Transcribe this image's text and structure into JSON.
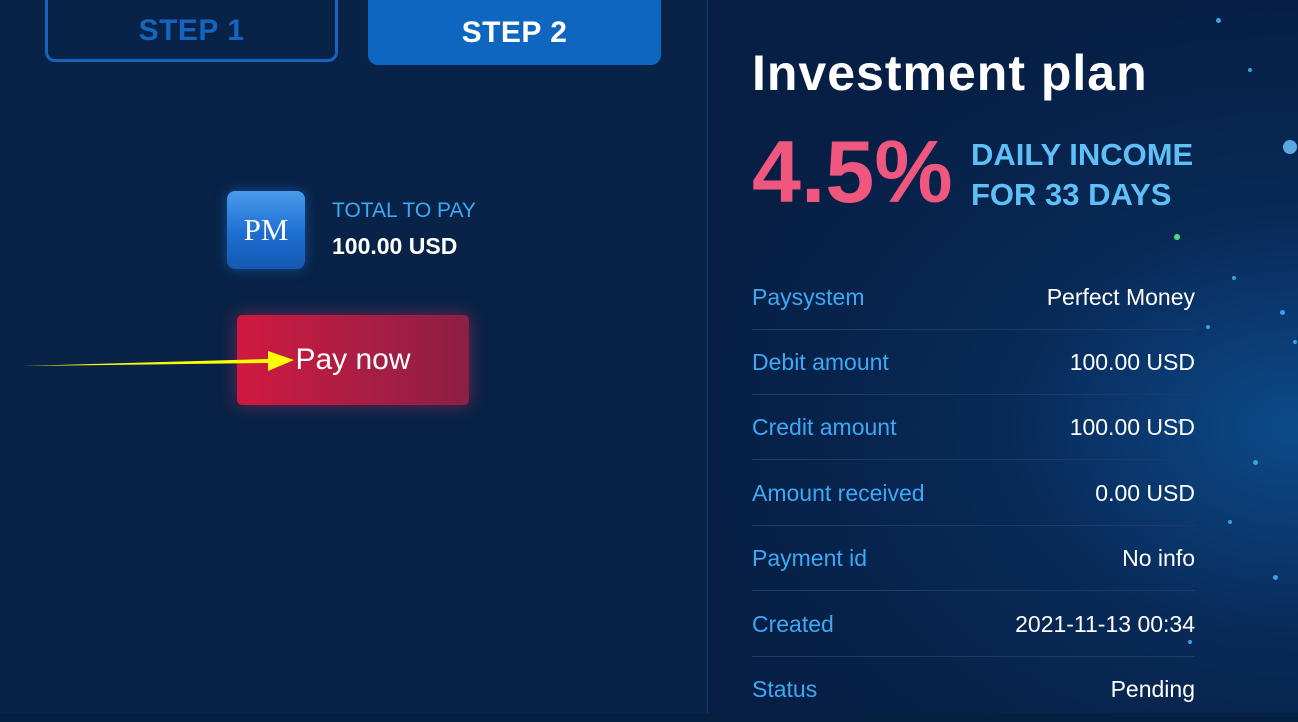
{
  "steps": {
    "step1_label": "STEP 1",
    "step2_label": "STEP 2"
  },
  "payment": {
    "logo_text": "PM",
    "total_label": "TOTAL TO PAY",
    "total_amount": "100.00 USD",
    "pay_button_label": "Pay now"
  },
  "plan": {
    "title": "Investment plan",
    "percent": "4.5%",
    "income_line1": "DAILY INCOME",
    "income_line2": "FOR 33 DAYS"
  },
  "details": [
    {
      "label": "Paysystem",
      "value": "Perfect Money"
    },
    {
      "label": "Debit amount",
      "value": "100.00 USD"
    },
    {
      "label": "Credit amount",
      "value": "100.00 USD"
    },
    {
      "label": "Amount received",
      "value": "0.00 USD"
    },
    {
      "label": "Payment id",
      "value": "No info"
    },
    {
      "label": "Created",
      "value": "2021-11-13 00:34"
    },
    {
      "label": "Status",
      "value": "Pending"
    }
  ],
  "colors": {
    "accent_blue": "#0e66c0",
    "label_blue": "#3da9f5",
    "pink": "#f0577f",
    "button_red": "#d0193f",
    "arrow_yellow": "#ffff00"
  },
  "icons": {
    "arrow": "arrow-right-icon",
    "logo": "perfect-money-logo-icon"
  }
}
